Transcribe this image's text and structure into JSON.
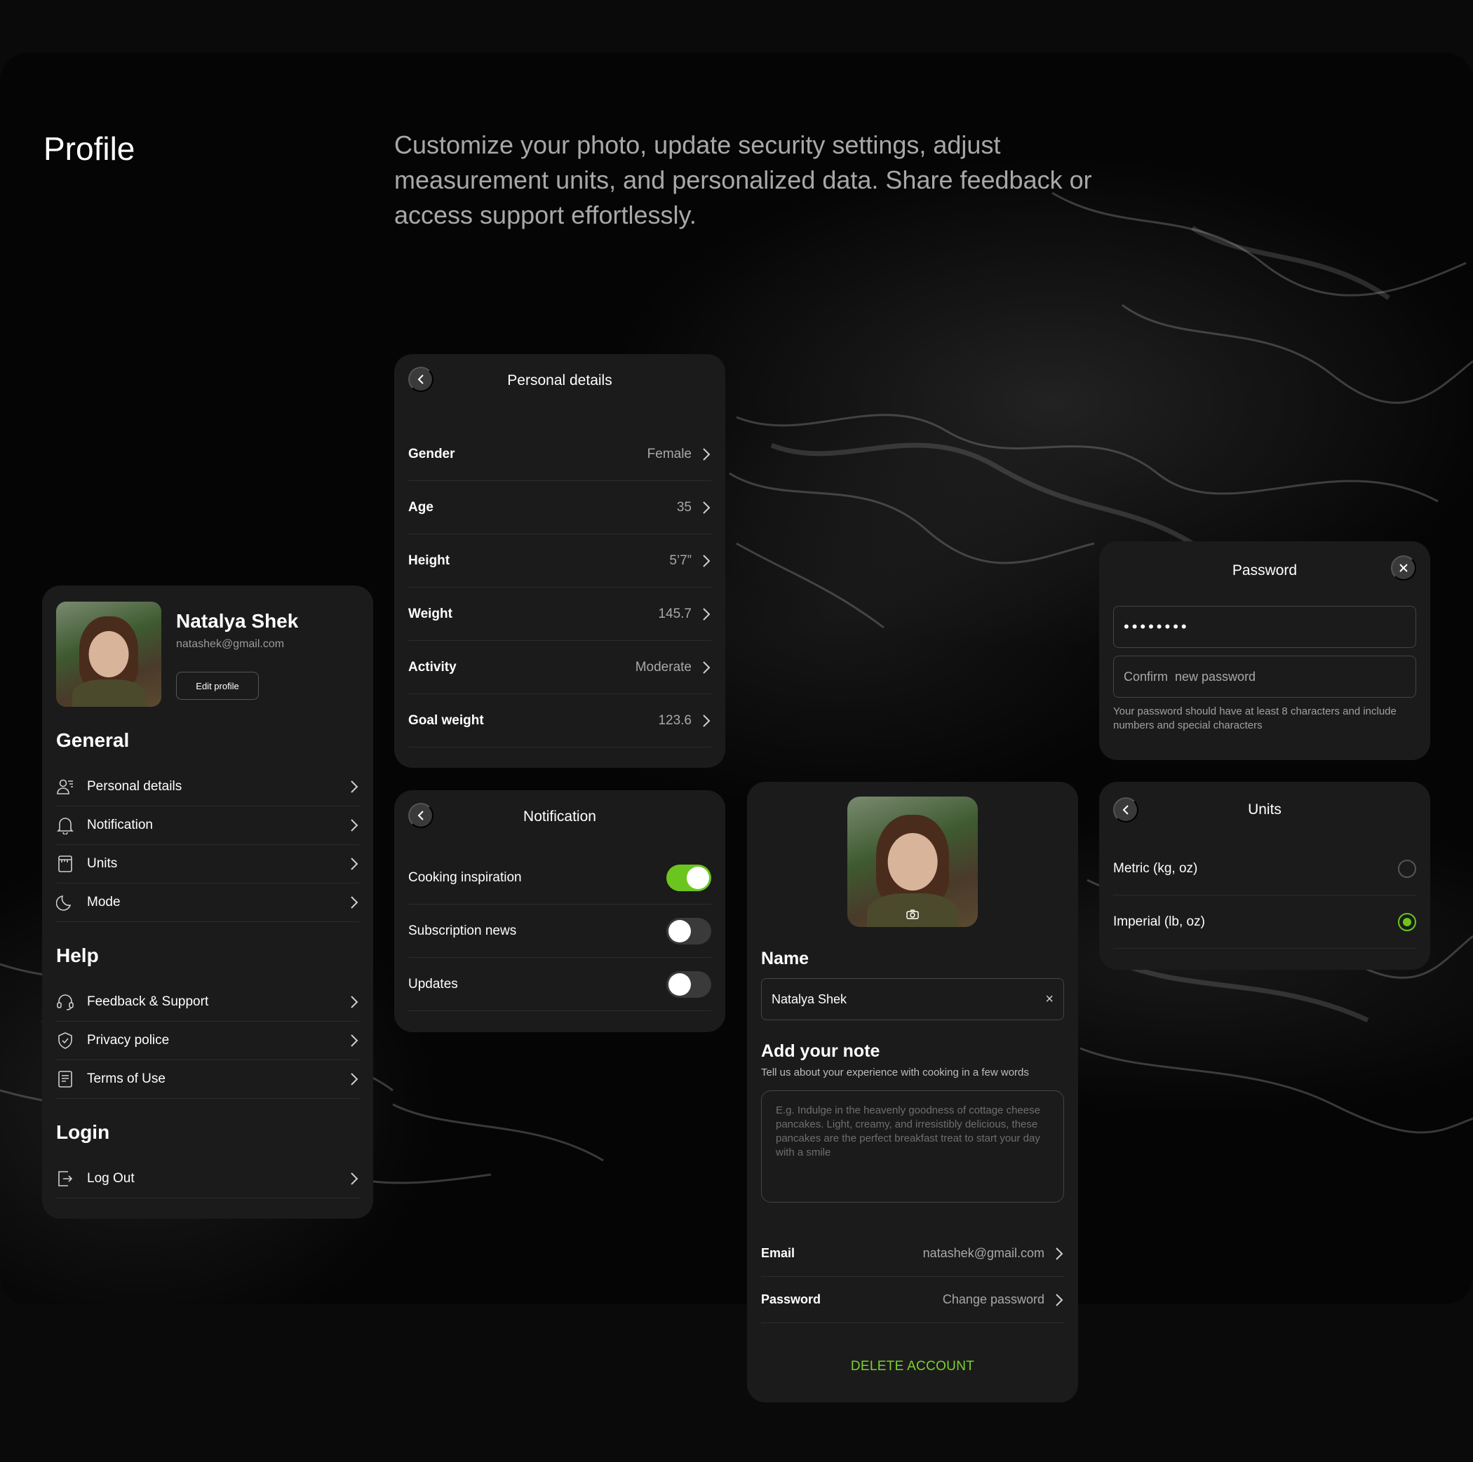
{
  "hero": {
    "title": "Profile",
    "description": "Customize your photo, update security settings, adjust measurement units, and personalized data. Share feedback or access support effortlessly."
  },
  "colors": {
    "accent": "#6bc51e",
    "card": "#1b1b1b",
    "background": "#0a0a0a"
  },
  "profile": {
    "name": "Natalya Shek",
    "email": "natashek@gmail.com",
    "edit_label": "Edit profile",
    "general_title": "General",
    "general_items": [
      {
        "label": "Personal details",
        "icon": "person-icon"
      },
      {
        "label": "Notification",
        "icon": "bell-icon"
      },
      {
        "label": "Units",
        "icon": "scale-icon"
      },
      {
        "label": "Mode",
        "icon": "moon-icon"
      }
    ],
    "help_title": "Help",
    "help_items": [
      {
        "label": "Feedback & Support",
        "icon": "headset-icon"
      },
      {
        "label": "Privacy police",
        "icon": "shield-icon"
      },
      {
        "label": "Terms of Use",
        "icon": "document-icon"
      }
    ],
    "login_title": "Login",
    "login_items": [
      {
        "label": "Log Out",
        "icon": "logout-icon"
      }
    ]
  },
  "personal_details": {
    "title": "Personal details",
    "rows": [
      {
        "label": "Gender",
        "value": "Female"
      },
      {
        "label": "Age",
        "value": "35"
      },
      {
        "label": "Height",
        "value": "5’7”"
      },
      {
        "label": "Weight",
        "value": "145.7"
      },
      {
        "label": "Activity",
        "value": "Moderate"
      },
      {
        "label": "Goal weight",
        "value": "123.6"
      }
    ]
  },
  "notification": {
    "title": "Notification",
    "rows": [
      {
        "label": "Cooking inspiration",
        "on": true
      },
      {
        "label": "Subscription news",
        "on": false
      },
      {
        "label": "Updates",
        "on": false
      }
    ]
  },
  "edit_profile": {
    "name_label": "Name",
    "name_value": "Natalya Shek",
    "clear_glyph": "×",
    "note_title": "Add your note",
    "note_subtitle": "Tell us about your experience with cooking in a few words",
    "note_placeholder": "E.g. Indulge in the heavenly goodness of cottage cheese pancakes. Light, creamy, and irresistibly delicious, these pancakes are the perfect breakfast treat to start your day with a smile",
    "rows": [
      {
        "label": "Email",
        "value": "natashek@gmail.com"
      },
      {
        "label": "Password",
        "value": "Change password"
      }
    ],
    "delete_label": "DELETE ACCOUNT"
  },
  "password": {
    "title": "Password",
    "current_value": "••••••••",
    "confirm_placeholder": "Confirm  new password",
    "hint": "Your password should have at least 8 characters and include numbers and special characters"
  },
  "units": {
    "title": "Units",
    "options": [
      {
        "label": "Metric (kg, oz)",
        "selected": false
      },
      {
        "label": "Imperial (lb, oz)",
        "selected": true
      }
    ]
  }
}
